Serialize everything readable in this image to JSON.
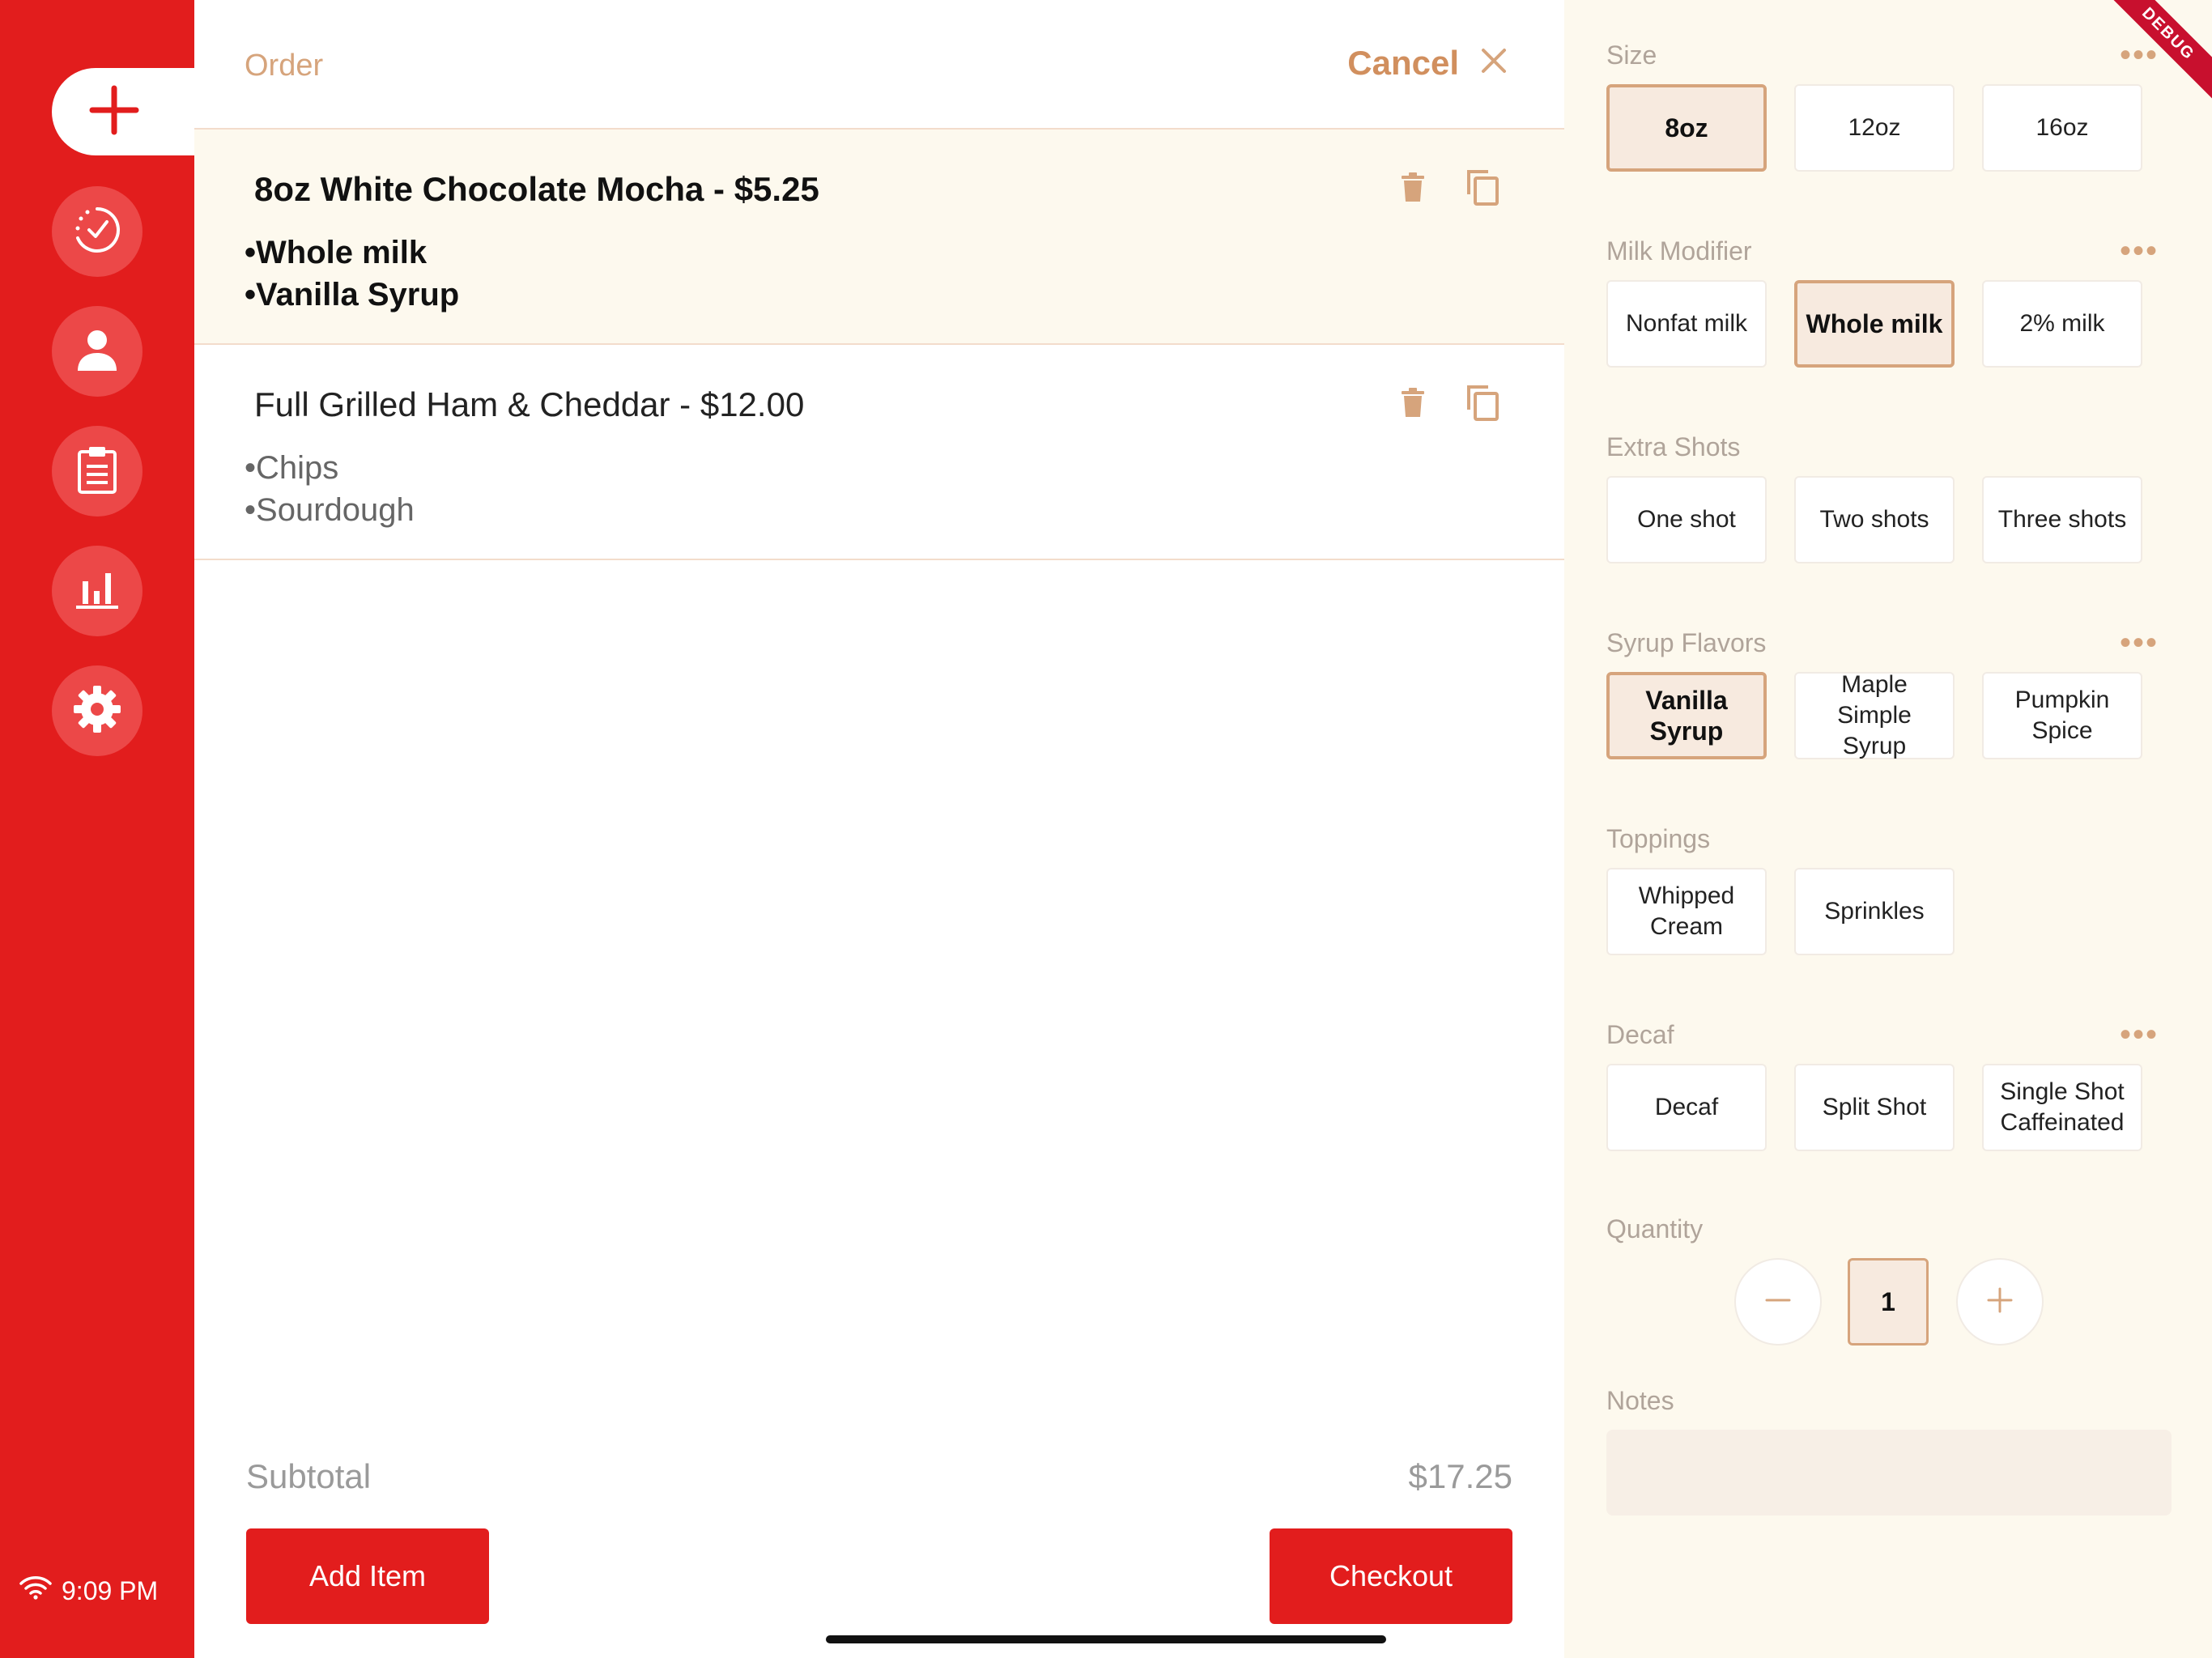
{
  "sidebar": {
    "nav": [
      {
        "name": "new-order",
        "icon": "plus-icon"
      },
      {
        "name": "orders-in-progress",
        "icon": "check-circle-icon"
      },
      {
        "name": "customers",
        "icon": "person-icon"
      },
      {
        "name": "order-history",
        "icon": "clipboard-icon"
      },
      {
        "name": "reports",
        "icon": "bar-chart-icon"
      },
      {
        "name": "settings",
        "icon": "gear-icon"
      }
    ],
    "status": {
      "time": "9:09 PM",
      "icon": "wifi-icon"
    }
  },
  "order": {
    "title": "Order",
    "cancel_label": "Cancel",
    "items": [
      {
        "title": "8oz White Chocolate Mocha  - $5.25",
        "modifiers": [
          "Whole milk",
          "Vanilla Syrup"
        ],
        "selected": true
      },
      {
        "title": "Full Grilled Ham & Cheddar  - $12.00",
        "modifiers": [
          "Chips",
          "Sourdough"
        ],
        "selected": false
      }
    ],
    "bullet": "•",
    "subtotal_label": "Subtotal",
    "subtotal_value": "$17.25",
    "add_item_label": "Add Item",
    "checkout_label": "Checkout"
  },
  "modifiers": {
    "groups": [
      {
        "label": "Size",
        "options": [
          "8oz",
          "12oz",
          "16oz"
        ],
        "selected": "8oz"
      },
      {
        "label": "Milk Modifier",
        "options": [
          "Nonfat milk",
          "Whole milk",
          "2% milk"
        ],
        "selected": "Whole milk"
      },
      {
        "label": "Extra Shots",
        "options": [
          "One shot",
          "Two shots",
          "Three shots"
        ],
        "selected": null
      },
      {
        "label": "Syrup Flavors",
        "options": [
          "Vanilla Syrup",
          "Maple Simple Syrup",
          "Pumpkin Spice"
        ],
        "selected": "Vanilla Syrup"
      },
      {
        "label": "Toppings",
        "options": [
          "Whipped Cream",
          "Sprinkles"
        ],
        "selected": null
      },
      {
        "label": "Decaf",
        "options": [
          "Decaf",
          "Split Shot",
          "Single Shot Caffeinated"
        ],
        "selected": null
      }
    ],
    "more_label": "•••",
    "quantity_label": "Quantity",
    "quantity_value": "1",
    "notes_label": "Notes",
    "debug_banner": "DEBUG"
  },
  "colors": {
    "brand_red": "#e21d1d",
    "accent_tan": "#d6a47c",
    "panel_cream": "#fdf9ee",
    "selected_fill": "#f7eadf"
  }
}
